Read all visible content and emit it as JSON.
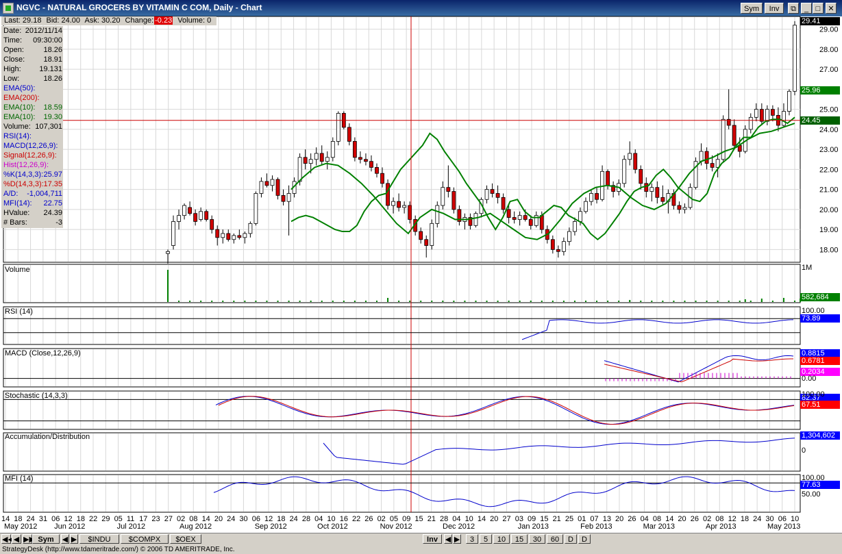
{
  "window": {
    "title": "NGVC - NATURAL GROCERS BY VITAMIN C COM, Daily - Chart",
    "sym_button": "Sym",
    "inv_button": "Inv"
  },
  "quote": {
    "last": "Last: 29.18",
    "bid": "Bid: 24.00",
    "ask": "Ask: 30.20",
    "change_label": "Change:",
    "change_value": "-0.23",
    "volume": "Volume: 0"
  },
  "data_panel": [
    {
      "label": "Date:",
      "value": "2012/11/14",
      "color": "#000000"
    },
    {
      "label": "Time:",
      "value": "09:30:00",
      "color": "#000000"
    },
    {
      "label": "Open:",
      "value": "18.26",
      "color": "#000000"
    },
    {
      "label": "Close:",
      "value": "18.91",
      "color": "#000000"
    },
    {
      "label": "High:",
      "value": "19.131",
      "color": "#000000"
    },
    {
      "label": "Low:",
      "value": "18.26",
      "color": "#000000"
    },
    {
      "label": "EMA(50):",
      "value": "",
      "color": "#0000cc"
    },
    {
      "label": "EMA(200):",
      "value": "",
      "color": "#cc0000"
    },
    {
      "label": "EMA(10):",
      "value": "18.59",
      "color": "#006600"
    },
    {
      "label": "EMA(10):",
      "value": "19.30",
      "color": "#006600"
    },
    {
      "label": "Volume:",
      "value": "107,301",
      "color": "#000000"
    },
    {
      "label": "RSI(14):",
      "value": "",
      "color": "#0000cc"
    },
    {
      "label": "MACD(12,26,9):",
      "value": "",
      "color": "#0000cc"
    },
    {
      "label": "Signal(12,26,9):",
      "value": "",
      "color": "#cc0000"
    },
    {
      "label": "Hist(12,26,9):",
      "value": "",
      "color": "#cc00cc"
    },
    {
      "label": "%K(14,3,3):",
      "value": "25.97",
      "color": "#0000cc"
    },
    {
      "label": "%D(14,3,3):",
      "value": "17.35",
      "color": "#cc0000"
    },
    {
      "label": "A/D:",
      "value": "-1,004,711",
      "color": "#0000cc"
    },
    {
      "label": "MFI(14):",
      "value": "22.75",
      "color": "#0000cc"
    },
    {
      "label": "HValue:",
      "value": "24.39",
      "color": "#000000"
    },
    {
      "label": "# Bars:",
      "value": "-3",
      "color": "#000000"
    }
  ],
  "price_axis": [
    "29.00",
    "28.00",
    "27.00",
    "26.00",
    "25.00",
    "24.00",
    "23.00",
    "22.00",
    "21.00",
    "20.00",
    "19.00",
    "18.00"
  ],
  "price_tags": [
    {
      "text": "29.41",
      "color": "#000000"
    },
    {
      "text": "25.96",
      "color": "#008000"
    },
    {
      "text": "24.45",
      "color": "#006000"
    }
  ],
  "panes": {
    "volume": {
      "label": "Volume",
      "axis_top": "1M",
      "tag": "582,684",
      "tag_color": "#008000"
    },
    "rsi": {
      "label": "RSI (14)",
      "axis_top": "100.00",
      "tag": "73.89",
      "tag_color": "#0000ff"
    },
    "macd": {
      "label": "MACD (Close,12,26,9)",
      "tag1": "0.8815",
      "tag1_color": "#0000ff",
      "tag2": "0.6781",
      "tag2_color": "#ff0000",
      "tag3": "0.2034",
      "tag3_color": "#ff00ff",
      "axis_bottom": "0.00"
    },
    "stochastic": {
      "label": "Stochastic (14,3,3)",
      "axis_top": "100.00",
      "tag1": "82.37",
      "tag1_color": "#0000ff",
      "tag2": "67.51",
      "tag2_color": "#ff0000"
    },
    "ad": {
      "label": "Accumulation/Distribution",
      "tag": "1,304,602",
      "tag_color": "#0000ff",
      "axis_zero": "0"
    },
    "mfi": {
      "label": "MFI (14)",
      "axis_top": "100.00",
      "tag": "77.63",
      "tag_color": "#0000ff",
      "axis_mid": "50.00"
    }
  },
  "x_days": [
    "14",
    "18",
    "24",
    "31",
    "06",
    "12",
    "18",
    "22",
    "29",
    "05",
    "11",
    "17",
    "23",
    "27",
    "02",
    "08",
    "14",
    "20",
    "24",
    "30",
    "06",
    "12",
    "18",
    "24",
    "28",
    "04",
    "10",
    "16",
    "22",
    "26",
    "02",
    "05",
    "09",
    "15",
    "21",
    "28",
    "04",
    "10",
    "14",
    "20",
    "27",
    "03",
    "09",
    "15",
    "21",
    "25",
    "01",
    "07",
    "13",
    "20",
    "26",
    "04",
    "08",
    "14",
    "20",
    "26",
    "02",
    "08",
    "12",
    "18",
    "24",
    "30",
    "06",
    "10"
  ],
  "x_months": [
    {
      "text": "May 2012",
      "day": 0
    },
    {
      "text": "Jun 2012",
      "day": 4
    },
    {
      "text": "Jul 2012",
      "day": 9
    },
    {
      "text": "Aug 2012",
      "day": 14
    },
    {
      "text": "Sep 2012",
      "day": 20
    },
    {
      "text": "Oct 2012",
      "day": 25
    },
    {
      "text": "Nov 2012",
      "day": 30
    },
    {
      "text": "Dec 2012",
      "day": 35
    },
    {
      "text": "Jan 2013",
      "day": 41
    },
    {
      "text": "Feb 2013",
      "day": 46
    },
    {
      "text": "Mar 2013",
      "day": 51
    },
    {
      "text": "Apr 2013",
      "day": 56
    },
    {
      "text": "May 2013",
      "day": 62
    }
  ],
  "bottom_bar": {
    "sym_button": "Sym",
    "tabs": [
      "$INDU",
      "$COMPX",
      "$OEX"
    ],
    "inv_button": "Inv",
    "periods": [
      "3",
      "5",
      "10",
      "15",
      "30",
      "60",
      "D",
      "D"
    ]
  },
  "status_text": "StrategyDesk (http://www.tdameritrade.com/) © 2006 TD AMERITRADE, Inc.",
  "colors": {
    "up_candle": "#ffffff",
    "down_candle": "#d00000",
    "ema": "#008000",
    "crosshair": "#cc0000",
    "grid": "#d8d8d8"
  },
  "chart_data": {
    "type": "candlestick",
    "symbol": "NGVC",
    "interval": "Daily",
    "ylim": [
      17.5,
      29.5
    ],
    "ohlc": [
      [
        17.8,
        18.0,
        17.3,
        17.9
      ],
      [
        18.2,
        19.7,
        18.0,
        19.4
      ],
      [
        19.4,
        20.0,
        19.0,
        19.7
      ],
      [
        19.7,
        20.3,
        19.5,
        20.2
      ],
      [
        20.1,
        20.4,
        19.7,
        19.8
      ],
      [
        19.8,
        20.0,
        19.2,
        19.4
      ],
      [
        19.5,
        20.1,
        19.4,
        19.9
      ],
      [
        19.9,
        20.0,
        19.4,
        19.5
      ],
      [
        19.5,
        19.7,
        18.8,
        19.0
      ],
      [
        19.0,
        19.2,
        18.2,
        18.6
      ],
      [
        18.6,
        19.0,
        18.3,
        18.8
      ],
      [
        18.8,
        19.0,
        18.4,
        18.5
      ],
      [
        18.5,
        18.8,
        18.3,
        18.7
      ],
      [
        18.7,
        19.0,
        18.5,
        18.6
      ],
      [
        18.6,
        18.9,
        18.3,
        18.8
      ],
      [
        18.8,
        19.4,
        18.6,
        19.3
      ],
      [
        19.3,
        20.9,
        19.2,
        20.8
      ],
      [
        20.8,
        21.6,
        20.6,
        21.4
      ],
      [
        21.4,
        21.8,
        21.1,
        21.2
      ],
      [
        21.2,
        21.7,
        20.9,
        21.5
      ],
      [
        21.5,
        21.6,
        20.5,
        20.7
      ],
      [
        20.7,
        21.0,
        20.2,
        20.4
      ],
      [
        20.4,
        21.2,
        18.7,
        20.8
      ],
      [
        20.8,
        21.6,
        20.6,
        21.4
      ],
      [
        21.4,
        22.8,
        21.2,
        22.6
      ],
      [
        22.6,
        23.0,
        22.0,
        22.3
      ],
      [
        22.3,
        22.8,
        21.8,
        22.5
      ],
      [
        22.5,
        23.1,
        22.2,
        22.8
      ],
      [
        22.8,
        23.2,
        22.2,
        22.4
      ],
      [
        22.4,
        22.9,
        22.0,
        22.6
      ],
      [
        22.6,
        23.6,
        22.4,
        23.4
      ],
      [
        23.4,
        24.9,
        23.2,
        24.8
      ],
      [
        24.8,
        24.9,
        24.0,
        24.1
      ],
      [
        24.1,
        24.3,
        23.2,
        23.4
      ],
      [
        23.4,
        23.6,
        22.4,
        22.6
      ],
      [
        22.6,
        22.9,
        22.3,
        22.5
      ],
      [
        22.5,
        22.8,
        22.2,
        22.4
      ],
      [
        22.4,
        22.7,
        21.9,
        22.1
      ],
      [
        22.1,
        22.3,
        21.6,
        21.8
      ],
      [
        21.8,
        22.1,
        21.1,
        21.3
      ],
      [
        21.3,
        21.5,
        20.0,
        20.2
      ],
      [
        20.2,
        20.6,
        19.8,
        20.4
      ],
      [
        20.4,
        20.8,
        19.9,
        20.1
      ],
      [
        20.1,
        20.4,
        19.8,
        20.2
      ],
      [
        20.2,
        20.4,
        19.3,
        19.5
      ],
      [
        19.5,
        19.7,
        18.7,
        18.9
      ],
      [
        18.9,
        19.1,
        18.3,
        18.5
      ],
      [
        18.5,
        18.7,
        17.6,
        18.2
      ],
      [
        18.2,
        19.5,
        18.0,
        19.3
      ],
      [
        19.3,
        20.4,
        19.1,
        20.2
      ],
      [
        20.2,
        21.4,
        20.0,
        21.1
      ],
      [
        21.1,
        22.2,
        20.6,
        20.9
      ],
      [
        20.9,
        21.1,
        19.8,
        20.0
      ],
      [
        20.0,
        20.2,
        19.2,
        19.4
      ],
      [
        19.4,
        19.8,
        19.0,
        19.6
      ],
      [
        19.6,
        19.8,
        19.0,
        19.2
      ],
      [
        19.2,
        19.9,
        19.1,
        19.8
      ],
      [
        19.8,
        20.6,
        19.6,
        20.5
      ],
      [
        20.5,
        21.2,
        20.3,
        21.0
      ],
      [
        21.0,
        21.3,
        20.6,
        20.8
      ],
      [
        20.8,
        21.2,
        20.3,
        20.6
      ],
      [
        20.6,
        20.8,
        19.8,
        20.0
      ],
      [
        20.0,
        20.3,
        19.3,
        19.6
      ],
      [
        19.6,
        19.9,
        19.3,
        19.5
      ],
      [
        19.5,
        19.9,
        19.2,
        19.7
      ],
      [
        19.7,
        20.0,
        19.4,
        19.5
      ],
      [
        19.5,
        19.7,
        19.0,
        19.2
      ],
      [
        19.2,
        19.9,
        19.1,
        19.7
      ],
      [
        19.7,
        19.9,
        18.8,
        19.0
      ],
      [
        19.0,
        19.2,
        18.3,
        18.5
      ],
      [
        18.5,
        18.7,
        17.8,
        18.0
      ],
      [
        18.0,
        18.2,
        17.6,
        17.9
      ],
      [
        17.9,
        18.6,
        17.7,
        18.4
      ],
      [
        18.4,
        19.1,
        18.2,
        18.9
      ],
      [
        18.9,
        19.6,
        18.7,
        19.4
      ],
      [
        19.4,
        20.1,
        19.2,
        19.9
      ],
      [
        19.9,
        20.6,
        19.8,
        20.4
      ],
      [
        20.4,
        21.0,
        20.2,
        20.8
      ],
      [
        20.8,
        21.1,
        20.3,
        20.5
      ],
      [
        20.5,
        22.2,
        20.4,
        21.9
      ],
      [
        21.9,
        22.0,
        21.0,
        21.2
      ],
      [
        21.2,
        21.4,
        20.6,
        20.9
      ],
      [
        20.9,
        21.5,
        20.7,
        21.3
      ],
      [
        21.3,
        22.7,
        21.1,
        22.5
      ],
      [
        22.5,
        23.4,
        22.2,
        22.8
      ],
      [
        22.8,
        23.0,
        21.8,
        22.0
      ],
      [
        22.0,
        22.2,
        21.0,
        21.3
      ],
      [
        21.3,
        21.6,
        20.6,
        20.9
      ],
      [
        20.9,
        21.3,
        20.4,
        21.1
      ],
      [
        21.1,
        21.4,
        20.3,
        20.6
      ],
      [
        20.6,
        21.2,
        20.2,
        20.4
      ],
      [
        20.4,
        21.0,
        19.8,
        20.8
      ],
      [
        20.8,
        21.0,
        20.0,
        20.2
      ],
      [
        20.2,
        20.4,
        19.8,
        20.0
      ],
      [
        20.0,
        20.3,
        19.8,
        20.1
      ],
      [
        20.1,
        21.3,
        20.0,
        21.1
      ],
      [
        21.1,
        22.6,
        21.0,
        22.4
      ],
      [
        22.4,
        23.3,
        22.2,
        22.9
      ],
      [
        22.9,
        23.1,
        22.0,
        22.3
      ],
      [
        22.3,
        22.7,
        21.9,
        22.1
      ],
      [
        22.1,
        22.8,
        21.6,
        22.5
      ],
      [
        22.5,
        24.7,
        22.4,
        24.5
      ],
      [
        24.5,
        26.0,
        24.0,
        24.2
      ],
      [
        24.2,
        24.5,
        23.0,
        23.2
      ],
      [
        23.2,
        23.6,
        22.6,
        22.9
      ],
      [
        22.9,
        24.2,
        22.8,
        24.0
      ],
      [
        24.0,
        24.8,
        23.8,
        24.6
      ],
      [
        24.6,
        25.3,
        24.4,
        25.0
      ],
      [
        25.0,
        25.3,
        24.2,
        24.4
      ],
      [
        24.4,
        25.2,
        24.2,
        25.0
      ],
      [
        25.0,
        25.2,
        24.4,
        24.7
      ],
      [
        24.7,
        25.1,
        23.9,
        24.2
      ],
      [
        24.2,
        25.3,
        24.1,
        24.9
      ],
      [
        24.9,
        26.0,
        24.7,
        25.9
      ],
      [
        25.9,
        29.4,
        25.7,
        29.2
      ]
    ],
    "ema_fast": [
      19.4,
      19.6,
      19.7,
      19.6,
      19.4,
      19.2,
      19.0,
      18.9,
      18.9,
      19.2,
      19.9,
      20.4,
      20.7,
      20.8,
      21.4,
      22.0,
      22.4,
      22.8,
      23.2,
      23.8,
      23.5,
      22.9,
      22.4,
      21.9,
      21.3,
      20.8,
      20.3,
      19.6,
      19.0,
      19.6,
      20.4,
      20.5,
      19.9,
      19.6,
      19.6,
      19.9,
      20.2,
      20.1,
      19.7,
      19.5,
      19.3,
      18.8,
      18.5,
      18.8,
      19.3,
      19.8,
      20.4,
      20.9,
      21.1,
      21.2,
      21.7,
      22.0,
      21.6,
      21.1,
      20.8,
      20.5,
      20.4,
      20.8,
      21.8,
      22.3,
      22.6,
      23.2,
      23.6,
      23.6,
      24.1,
      24.4,
      24.5,
      24.5,
      24.3,
      24.6
    ],
    "ema_slow": [
      21.0,
      21.6,
      22.1,
      22.3,
      22.2,
      21.8,
      21.3,
      20.7,
      20.0,
      19.3,
      18.8,
      19.6,
      20.0,
      19.8,
      19.5,
      19.5,
      19.6,
      19.8,
      19.4,
      19.0,
      18.6,
      18.5,
      18.8,
      19.5,
      20.3,
      20.8,
      21.1,
      21.2,
      21.1,
      20.6,
      20.2,
      20.0,
      20.3,
      21.0,
      21.8,
      22.4,
      22.6,
      22.9,
      23.1,
      23.5,
      23.8,
      23.9,
      24.1,
      24.3
    ]
  }
}
